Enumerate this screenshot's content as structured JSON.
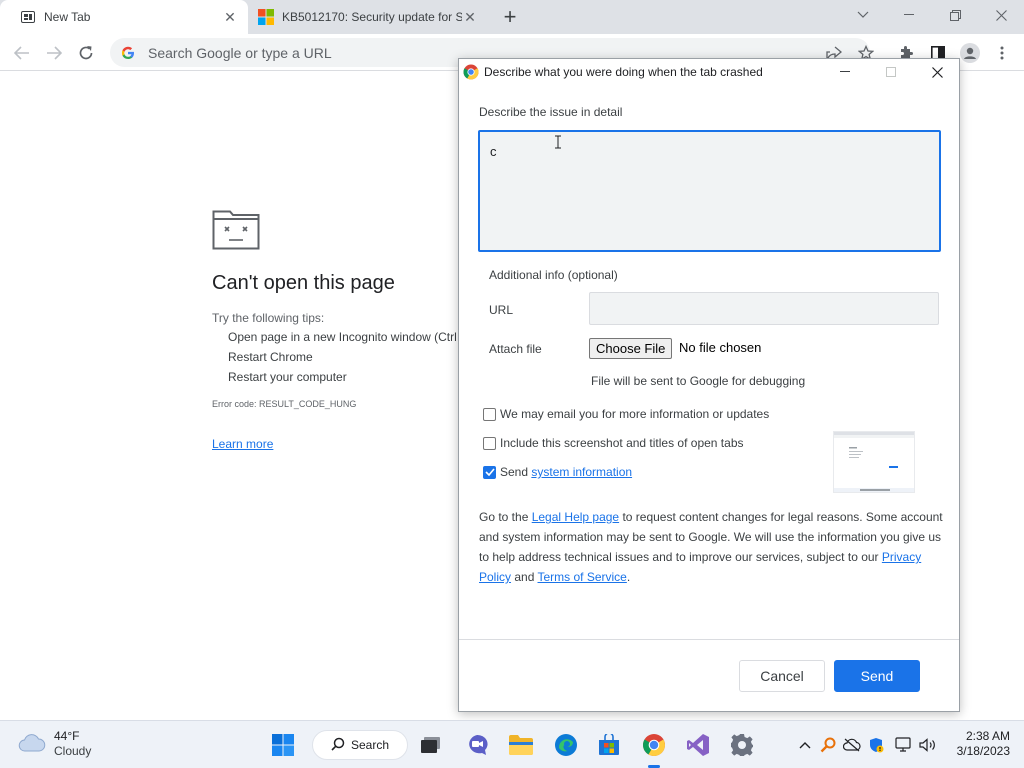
{
  "browser": {
    "tabs": [
      {
        "title": "New Tab",
        "close": "✕"
      },
      {
        "title": "KB5012170: Security update for S",
        "close": "✕"
      }
    ],
    "new_tab": "+",
    "omnibox_placeholder": "Search Google or type a URL"
  },
  "error_page": {
    "title": "Can't open this page",
    "tips_intro": "Try the following tips:",
    "tips": [
      "Open page in a new Incognito window (Ctrl",
      "Restart Chrome",
      "Restart your computer"
    ],
    "error_code": "Error code: RESULT_CODE_HUNG",
    "learn_more": "Learn more"
  },
  "dialog": {
    "title": "Describe what you were doing when the tab crashed",
    "issue_label": "Describe the issue in detail",
    "issue_value": "c",
    "additional_info": "Additional info (optional)",
    "url_label": "URL",
    "url_value": "",
    "attach_label": "Attach file",
    "choose_file": "Choose File",
    "no_file": "No file chosen",
    "file_note": "File will be sent to Google for debugging",
    "email_option": {
      "label": "We may email you for more information or updates",
      "checked": false
    },
    "screenshot_option": {
      "label": "Include this screenshot and titles of open tabs",
      "checked": false
    },
    "send_sysinfo": {
      "prefix": "Send ",
      "link": "system information",
      "checked": true
    },
    "legal": {
      "part1": "Go to the ",
      "legal_link": "Legal Help page",
      "part2": " to request content changes for legal reasons. Some account and system information may be sent to Google. We will use the information you give us to help address technical issues and to improve our services, subject to our ",
      "privacy_link": "Privacy Policy",
      "part3": " and ",
      "tos_link": "Terms of Service",
      "part4": "."
    },
    "cancel": "Cancel",
    "send": "Send"
  },
  "taskbar": {
    "weather_temp": "44°F",
    "weather_cond": "Cloudy",
    "search": "Search",
    "time": "2:38 AM",
    "date": "3/18/2023"
  },
  "colors": {
    "accent": "#1a73e8",
    "tabstrip": "#dee1e6",
    "taskbar": "#eef2f8"
  }
}
